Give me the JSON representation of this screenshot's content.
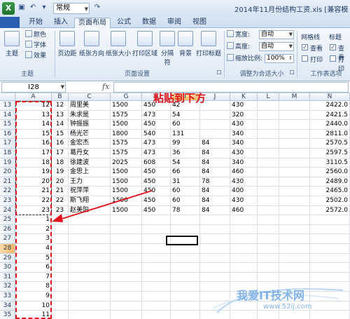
{
  "titlebar": {
    "app_icon": "excel-logo-icon",
    "style_value": "常规",
    "doc_title": "2014年11月份结构工资.xls [兼容模"
  },
  "tabs": [
    {
      "label": "开始",
      "active": false
    },
    {
      "label": "插入",
      "active": false
    },
    {
      "label": "页面布局",
      "active": true
    },
    {
      "label": "公式",
      "active": false
    },
    {
      "label": "数据",
      "active": false
    },
    {
      "label": "审阅",
      "active": false
    },
    {
      "label": "视图",
      "active": false
    }
  ],
  "ribbon": {
    "themes": {
      "main": "主题",
      "colors": "颜色",
      "fonts": "字体",
      "effects": "效果",
      "group": "主题"
    },
    "page_setup": {
      "margins": "页边距",
      "orientation": "纸张方向",
      "size": "纸张大小",
      "print_area": "打印区域",
      "breaks": "分隔符",
      "background": "背景",
      "print_titles": "打印标题",
      "group": "页面设置"
    },
    "scale": {
      "width_label": "宽度:",
      "width_value": "自动",
      "height_label": "高度:",
      "height_value": "自动",
      "scale_label": "缩放比例:",
      "scale_value": "100%",
      "group": "调整为合适大小"
    },
    "sheet_options": {
      "gridlines": "网格线",
      "headings": "标题",
      "view": "查看",
      "print": "打印",
      "gridlines_view_checked": true,
      "gridlines_print_checked": false,
      "headings_view_checked": true,
      "headings_print_checked": false,
      "group": "工作表选项"
    }
  },
  "formula_bar": {
    "name_box": "I28",
    "fx": "fx",
    "content": ""
  },
  "columns": [
    "A",
    "B",
    "C",
    "G",
    "H",
    "I",
    "J",
    "K",
    "L",
    "M",
    "N"
  ],
  "selected_column": "I",
  "rows": [
    {
      "row": "13",
      "a": "12",
      "b": "12",
      "c": "周里美",
      "g": "1500",
      "h": "450",
      "i": "42",
      "j": "",
      "k": "430",
      "n": "2422.0"
    },
    {
      "row": "14",
      "a": "13",
      "b": "13",
      "c": "朱求是",
      "g": "1575",
      "h": "473",
      "i": "54",
      "j": "",
      "k": "320",
      "n": "2421.5"
    },
    {
      "row": "15",
      "a": "14",
      "b": "14",
      "c": "钟振振",
      "g": "1500",
      "h": "450",
      "i": "60",
      "j": "",
      "k": "430",
      "n": "2440.0"
    },
    {
      "row": "16",
      "a": "15",
      "b": "15",
      "c": "杨光芒",
      "g": "1800",
      "h": "540",
      "i": "131",
      "j": "",
      "k": "340",
      "n": "2811.0"
    },
    {
      "row": "17",
      "a": "16",
      "b": "16",
      "c": "金宏杰",
      "g": "1575",
      "h": "473",
      "i": "99",
      "j": "84",
      "k": "340",
      "n": "2570.5"
    },
    {
      "row": "18",
      "a": "17",
      "b": "17",
      "c": "葛丹女",
      "g": "1575",
      "h": "473",
      "i": "36",
      "j": "84",
      "k": "430",
      "n": "2597.5"
    },
    {
      "row": "19",
      "a": "18",
      "b": "18",
      "c": "徐建波",
      "g": "2025",
      "h": "608",
      "i": "54",
      "j": "84",
      "k": "340",
      "n": "3110.5"
    },
    {
      "row": "20",
      "a": "19",
      "b": "19",
      "c": "金思上",
      "g": "1500",
      "h": "450",
      "i": "66",
      "j": "84",
      "k": "460",
      "n": "2560.0"
    },
    {
      "row": "21",
      "a": "20",
      "b": "20",
      "c": "王力",
      "g": "1500",
      "h": "450",
      "i": "31",
      "j": "78",
      "k": "430",
      "n": "2489.0"
    },
    {
      "row": "22",
      "a": "21",
      "b": "21",
      "c": "祝萍萍",
      "g": "1500",
      "h": "450",
      "i": "60",
      "j": "84",
      "k": "400",
      "n": "2465.0"
    },
    {
      "row": "23",
      "a": "22",
      "b": "22",
      "c": "斯飞翔",
      "g": "1500",
      "h": "450",
      "i": "60",
      "j": "84",
      "k": "430",
      "n": "2502.0"
    },
    {
      "row": "24",
      "a": "23",
      "b": "23",
      "c": "赵美阳",
      "g": "1500",
      "h": "450",
      "i": "78",
      "j": "84",
      "k": "460",
      "n": "2572.0"
    },
    {
      "row": "25",
      "a": "1"
    },
    {
      "row": "26",
      "a": "2"
    },
    {
      "row": "27",
      "a": "3"
    },
    {
      "row": "28",
      "a": "4",
      "selected": true
    },
    {
      "row": "29",
      "a": "5"
    },
    {
      "row": "30",
      "a": "6"
    },
    {
      "row": "31",
      "a": "7"
    },
    {
      "row": "32",
      "a": "8"
    },
    {
      "row": "33",
      "a": "9"
    },
    {
      "row": "34",
      "a": "10"
    },
    {
      "row": "35",
      "a": "11"
    }
  ],
  "annotation": {
    "text": "粘贴到下方",
    "color": "#e0141b"
  },
  "watermark": {
    "title": "我爱IT技术网",
    "url": "www.52ij.com"
  },
  "colors": {
    "accent_red": "#e0141b",
    "selected_header": "#f5b96a",
    "ribbon_blue": "#dfe9f5"
  }
}
